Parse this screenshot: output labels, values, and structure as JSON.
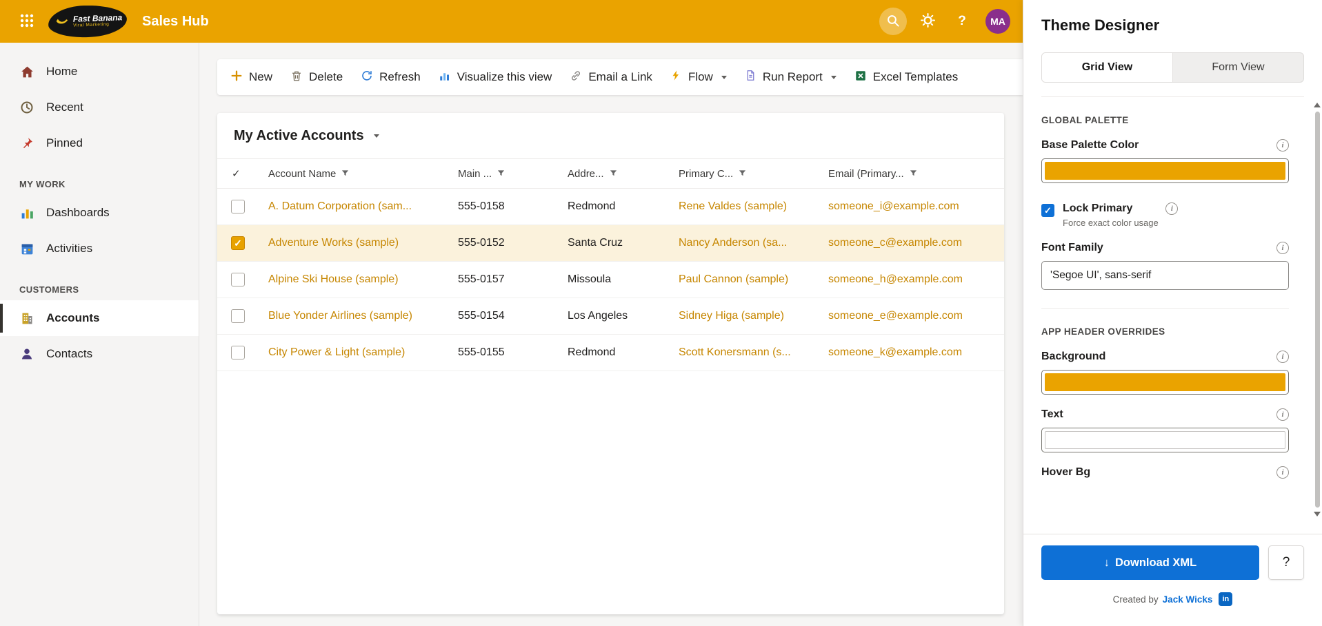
{
  "colors": {
    "primary": "#EAA300",
    "link": "#C68600",
    "selected_row_bg": "#FBF2DC",
    "accent_blue": "#0E70D6",
    "linkedin_blue": "#0A66C2",
    "avatar_bg": "#8A2E8C"
  },
  "topbar": {
    "app_title": "Sales Hub",
    "logo_line1": "Fast Banana",
    "logo_line2": "Viral Marketing",
    "help_label": "?",
    "avatar_initials": "MA"
  },
  "sidebar": {
    "top_items": [
      {
        "label": "Home"
      },
      {
        "label": "Recent"
      },
      {
        "label": "Pinned"
      }
    ],
    "section1_header": "MY WORK",
    "section1_items": [
      {
        "label": "Dashboards"
      },
      {
        "label": "Activities"
      }
    ],
    "section2_header": "CUSTOMERS",
    "section2_items": [
      {
        "label": "Accounts"
      },
      {
        "label": "Contacts"
      }
    ]
  },
  "commandbar": {
    "new_label": "New",
    "delete_label": "Delete",
    "refresh_label": "Refresh",
    "visualize_label": "Visualize this view",
    "email_label": "Email a Link",
    "flow_label": "Flow",
    "run_report_label": "Run Report",
    "excel_label": "Excel Templates"
  },
  "grid": {
    "view_title": "My Active Accounts",
    "header_check": "✓",
    "columns": {
      "name": "Account Name",
      "phone": "Main ...",
      "city": "Addre...",
      "contact": "Primary C...",
      "email": "Email (Primary..."
    },
    "rows": [
      {
        "name": "A. Datum Corporation (sam...",
        "phone": "555-0158",
        "city": "Redmond",
        "contact": "Rene Valdes (sample)",
        "email": "someone_i@example.com"
      },
      {
        "name": "Adventure Works (sample)",
        "phone": "555-0152",
        "city": "Santa Cruz",
        "contact": "Nancy Anderson (sa...",
        "email": "someone_c@example.com"
      },
      {
        "name": "Alpine Ski House (sample)",
        "phone": "555-0157",
        "city": "Missoula",
        "contact": "Paul Cannon (sample)",
        "email": "someone_h@example.com"
      },
      {
        "name": "Blue Yonder Airlines (sample)",
        "phone": "555-0154",
        "city": "Los Angeles",
        "contact": "Sidney Higa (sample)",
        "email": "someone_e@example.com"
      },
      {
        "name": "City Power & Light (sample)",
        "phone": "555-0155",
        "city": "Redmond",
        "contact": "Scott Konersmann (s...",
        "email": "someone_k@example.com"
      }
    ]
  },
  "theme_panel": {
    "title": "Theme Designer",
    "tab_grid": "Grid View",
    "tab_form": "Form View",
    "global_section": "GLOBAL PALETTE",
    "base_palette_label": "Base Palette Color",
    "base_palette_color": "#EAA300",
    "lock_primary_label": "Lock Primary",
    "lock_primary_sub": "Force exact color usage",
    "font_family_label": "Font Family",
    "font_family_value": "'Segoe UI', sans-serif",
    "header_section": "APP HEADER OVERRIDES",
    "background_label": "Background",
    "background_color": "#EAA300",
    "text_label": "Text",
    "text_color": "#FFFFFF",
    "hover_label": "Hover Bg",
    "info_glyph": "i",
    "download_arrow": "↓",
    "download_label": "Download XML",
    "help_label": "?",
    "created_by": "Created by",
    "author": "Jack Wicks",
    "linkedin_glyph": "in"
  }
}
